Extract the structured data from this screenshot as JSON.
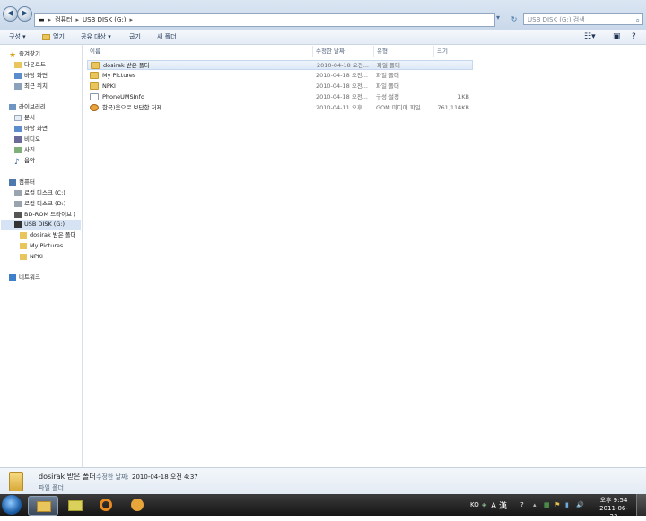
{
  "address": {
    "crumbs": [
      "컴퓨터",
      "USB DISK (G:)"
    ],
    "search_placeholder": "USB DISK (G:) 검색"
  },
  "toolbar": {
    "organize": "구성 ▾",
    "open": "열기",
    "share": "공유 대상 ▾",
    "burn": "굽기",
    "new_folder": "새 폴더"
  },
  "nav": {
    "favorites": "즐겨찾기",
    "fav_items": [
      "다운로드",
      "바탕 화면",
      "최근 위치"
    ],
    "libraries": "라이브러리",
    "lib_items": [
      "문서",
      "바탕 화면",
      "비디오",
      "사진",
      "음악"
    ],
    "computer": "컴퓨터",
    "comp_items": [
      "로컬 디스크 (C:)",
      "로컬 디스크 (D:)",
      "BD-ROM 드라이브 (",
      "USB DISK (G:)"
    ],
    "usb_items": [
      "dosirak 받은 폴더",
      "My Pictures",
      "NPKI"
    ],
    "network": "네트워크"
  },
  "columns": {
    "name": "이름",
    "date": "수정한 날짜",
    "type": "유형",
    "size": "크기"
  },
  "files": [
    {
      "name": "dosirak 받은 폴더",
      "date": "2010-04-18 오전...",
      "type": "파일 폴더",
      "size": ""
    },
    {
      "name": "My Pictures",
      "date": "2010-04-18 오전...",
      "type": "파일 폴더",
      "size": ""
    },
    {
      "name": "NPKI",
      "date": "2010-04-18 오전...",
      "type": "파일 폴더",
      "size": ""
    },
    {
      "name": "PhoneUMSInfo",
      "date": "2010-04-18 오전...",
      "type": "구성 설정",
      "size": "1KB"
    },
    {
      "name": "한국)음으로 보답한 처제",
      "date": "2010-04-11 오후...",
      "type": "GOM 미디어 파일...",
      "size": "761,114KB"
    }
  ],
  "details": {
    "name": "dosirak 받은 폴더",
    "modified_label": "수정한 날짜:",
    "modified_value": "2010-04-18 오전 4:37",
    "type": "파일 폴더"
  },
  "tray": {
    "lang": "KO",
    "ime": "A 漢",
    "time": "오후 9:54",
    "date": "2011-06-23"
  }
}
